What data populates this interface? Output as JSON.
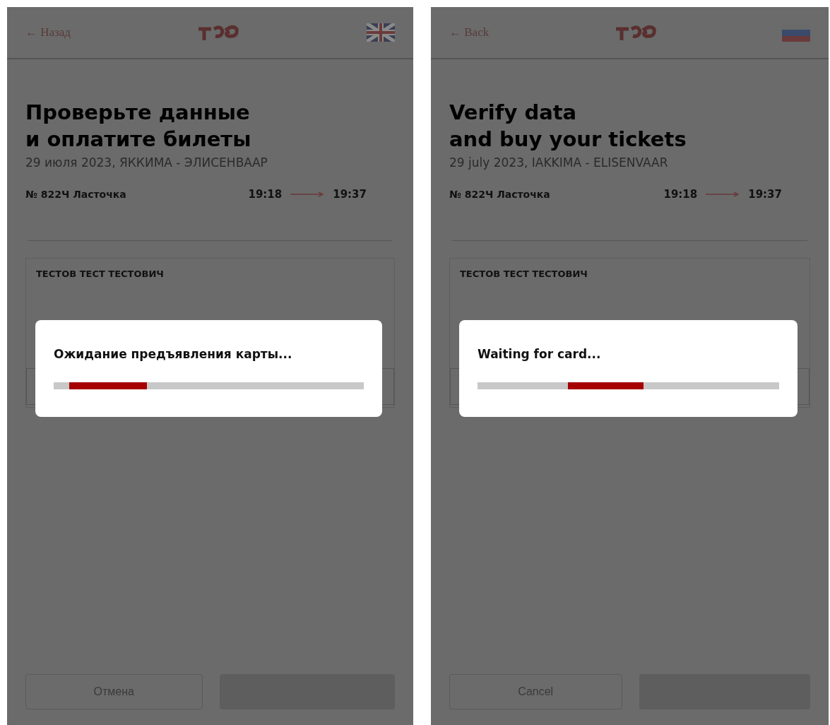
{
  "screens": [
    {
      "back": "← Назад",
      "language_flag": {
        "kind": "uk"
      },
      "title_lines": [
        "Проверьте данные",
        "и оплатите билеты"
      ],
      "subtitle": "29 июля 2023, ЯККИМА - ЭЛИСЕНВААР",
      "train": "№ 822Ч Ласточка",
      "departure_time": "19:18",
      "arrival_time": "19:37",
      "passenger": "ТЕСТОВ ТЕСТ ТЕСТОВИЧ",
      "dialog": {
        "message": "Ожидание предъявления карты..."
      },
      "cancel": "Отмена"
    },
    {
      "back": "← Back",
      "language_flag": {
        "kind": "ru"
      },
      "title_lines": [
        "Verify data",
        "and buy your tickets"
      ],
      "subtitle": "29 july 2023, IAKKIMA - ELISENVAAR",
      "train": "№ 822Ч Ласточка",
      "departure_time": "19:18",
      "arrival_time": "19:37",
      "passenger": "ТЕСТОВ ТЕСТ ТЕСТОВИЧ",
      "dialog": {
        "message": "Waiting for card..."
      },
      "cancel": "Cancel"
    }
  ]
}
